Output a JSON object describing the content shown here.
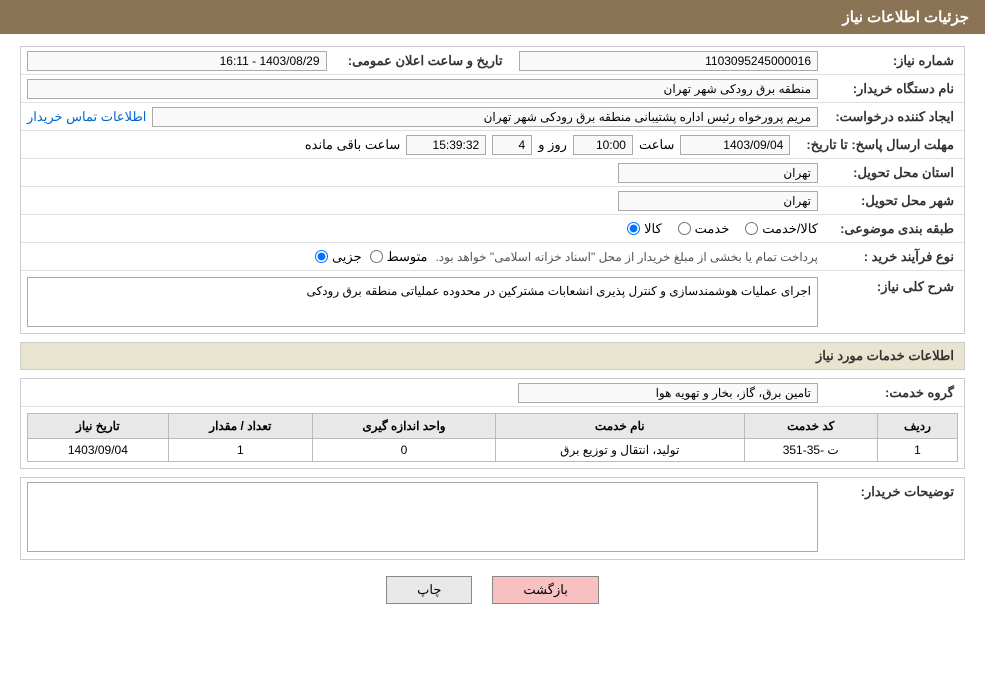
{
  "header": {
    "title": "جزئیات اطلاعات نیاز"
  },
  "fields": {
    "need_number_label": "شماره نیاز:",
    "need_number_value": "1103095245000016",
    "buyer_name_label": "نام دستگاه خریدار:",
    "buyer_name_value": "منطقه برق رودکی شهر تهران",
    "requester_label": "ایجاد کننده درخواست:",
    "requester_value": "مریم پرورخواه رئیس اداره پشتیبانی منطقه برق رودکی شهر تهران",
    "requester_link": "اطلاعات تماس خریدار",
    "announce_date_label": "تاریخ و ساعت اعلان عمومی:",
    "announce_date_value": "1403/08/29 - 16:11",
    "reply_deadline_label": "مهلت ارسال پاسخ: تا تاریخ:",
    "reply_date": "1403/09/04",
    "reply_time_label": "ساعت",
    "reply_time": "10:00",
    "reply_days_label": "روز و",
    "reply_days": "4",
    "reply_remaining_label": "ساعت باقی مانده",
    "reply_remaining": "15:39:32",
    "province_label": "استان محل تحویل:",
    "province_value": "تهران",
    "city_label": "شهر محل تحویل:",
    "city_value": "تهران",
    "category_label": "طبقه بندی موضوعی:",
    "category_kala": "کالا",
    "category_khedmat": "خدمت",
    "category_kala_khedmat": "کالا/خدمت",
    "purchase_type_label": "نوع فرآیند خرید :",
    "purchase_jozee": "جزیی",
    "purchase_motavasset": "متوسط",
    "purchase_note": "پرداخت تمام یا بخشی از مبلغ خریدار از محل \"اسناد خزانه اسلامی\" خواهد بود.",
    "need_desc_label": "شرح کلی نیاز:",
    "need_desc_value": "اجرای عملیات هوشمندسازی و کنترل پذیری انشعابات مشترکین در محدوده عملیاتی منطقه برق رودکی",
    "services_info_title": "اطلاعات خدمات مورد نیاز",
    "service_group_label": "گروه خدمت:",
    "service_group_value": "تامین برق، گاز، بخار و تهویه هوا",
    "table_headers": {
      "col1": "ردیف",
      "col2": "کد خدمت",
      "col3": "نام خدمت",
      "col4": "واحد اندازه گیری",
      "col5": "تعداد / مقدار",
      "col6": "تاریخ نیاز"
    },
    "table_rows": [
      {
        "row": "1",
        "code": "ت -35-351",
        "name": "تولید، انتقال و توزیع برق",
        "unit": "0",
        "qty": "1",
        "date": "1403/09/04"
      }
    ],
    "buyer_notes_label": "توضیحات خریدار:",
    "buyer_notes_value": ""
  },
  "buttons": {
    "print": "چاپ",
    "back": "بازگشت"
  }
}
